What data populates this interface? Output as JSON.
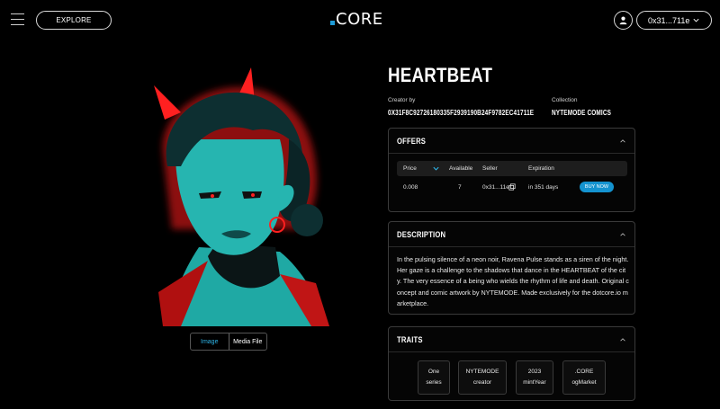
{
  "header": {
    "explore_label": "EXPLORE",
    "logo_text": "CORE",
    "wallet_label": "0x31...711e",
    "accent_color": "#1e9bd7"
  },
  "media": {
    "tabs": [
      "Image",
      "Media File"
    ],
    "active_tab": "Image"
  },
  "asset": {
    "title": "HEARTBEAT",
    "creator_label": "Creator by",
    "creator_value": "0X31F8C92726180335F2939190B24F9782EC41711E",
    "collection_label": "Collection",
    "collection_value": "NYTEMODE COMICS"
  },
  "offers": {
    "title": "OFFERS",
    "columns": [
      "Price",
      "Available",
      "Seller",
      "Expiration"
    ],
    "rows": [
      {
        "price": "0.008",
        "available": "7",
        "seller": "0x31...11e",
        "expiration": "in 351 days",
        "action": "BUY NOW"
      }
    ]
  },
  "description": {
    "title": "DESCRIPTION",
    "text": "In the pulsing silence of a neon noir, Ravena Pulse stands as a siren of the night. Her gaze is a challenge to the shadows that dance in the HEARTBEAT of the city. The very essence of a being who wields the rhythm of life and death. Original concept and comic artwork by NYTEMODE. Made exclusively for the dotcore.io marketplace."
  },
  "traits": {
    "title": "TRAITS",
    "items": [
      {
        "value": "One",
        "type": "series"
      },
      {
        "value": "NYTEMODE",
        "type": "creator"
      },
      {
        "value": "2023",
        "type": "mintYear"
      },
      {
        "value": ".CORE",
        "type": "ogMarket"
      }
    ]
  }
}
